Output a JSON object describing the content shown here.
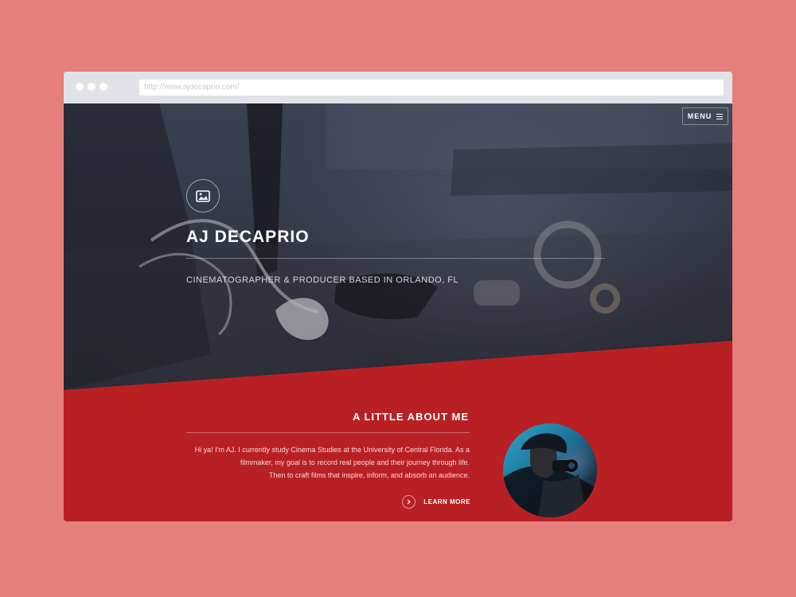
{
  "browser": {
    "address": "http://www.ajdecaprio.com/"
  },
  "nav": {
    "menu_label": "MENU"
  },
  "hero": {
    "name": "AJ DECAPRIO",
    "subtitle": "CINEMATOGRAPHER & PRODUCER BASED IN ORLANDO, FL"
  },
  "about": {
    "heading": "A LITTLE ABOUT ME",
    "paragraph_lines": [
      "Hi ya! I'm AJ. I currently study Cinema Studies at the University of Central Florida. As a",
      "filmmaker, my goal is to record real people and their journey through life.",
      "Then to craft films that inspire, inform, and absorb an audience."
    ],
    "cta_label": "LEARN MORE"
  },
  "colors": {
    "outer_background": "#e57f7c",
    "browser_bar": "#dfe3e8",
    "hero_overlay": "#2b2f3a",
    "accent_red": "#b92024"
  },
  "icons": {
    "menu": "hamburger-icon",
    "hero": "image-icon",
    "cta": "chevron-right-icon"
  }
}
